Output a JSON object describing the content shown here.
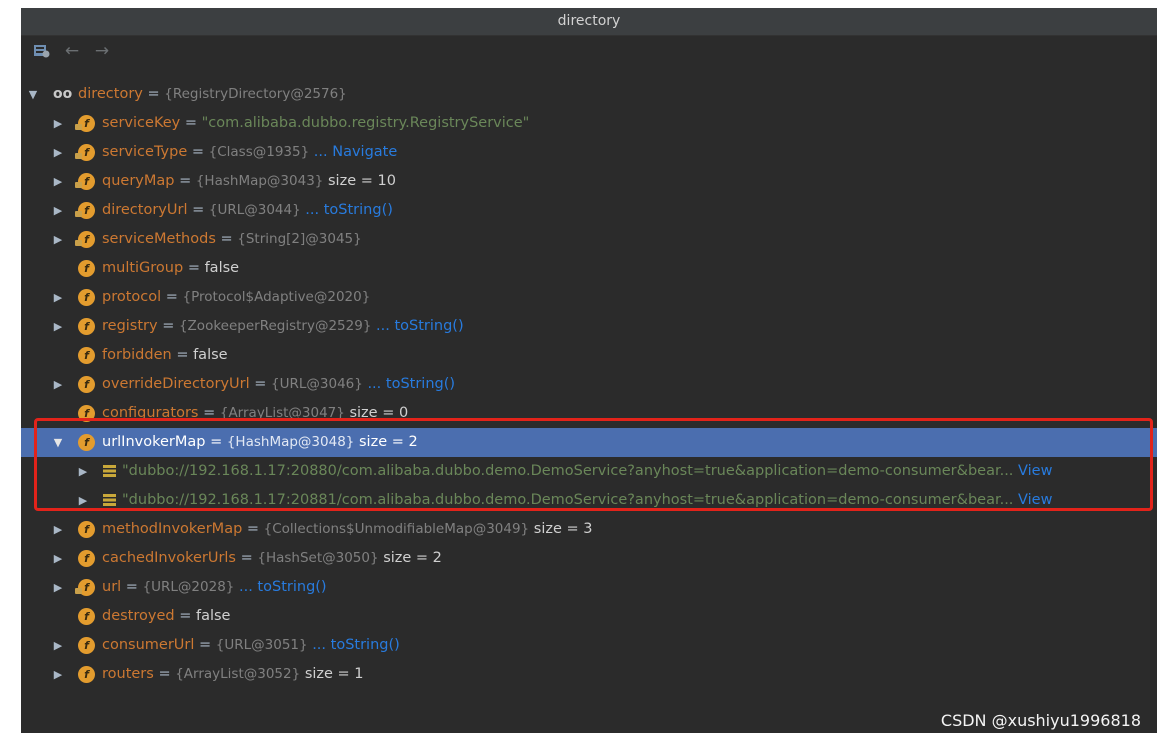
{
  "window": {
    "title": "directory"
  },
  "toolbar": {
    "back": "←",
    "forward": "→"
  },
  "tree": {
    "root": {
      "name": "directory",
      "eq": "=",
      "type": "{RegistryDirectory@2576}"
    },
    "rows": [
      {
        "name": "serviceKey",
        "eq": "=",
        "str": "\"com.alibaba.dubbo.registry.RegistryService\""
      },
      {
        "name": "serviceType",
        "eq": "=",
        "type": "{Class@1935}",
        "link": "... Navigate"
      },
      {
        "name": "queryMap",
        "eq": "=",
        "type": "{HashMap@3043}",
        "extra": "size = 10"
      },
      {
        "name": "directoryUrl",
        "eq": "=",
        "type": "{URL@3044}",
        "link": "... toString()"
      },
      {
        "name": "serviceMethods",
        "eq": "=",
        "type": "{String[2]@3045}"
      },
      {
        "name": "multiGroup",
        "eq": "=",
        "extra": "false"
      },
      {
        "name": "protocol",
        "eq": "=",
        "type": "{Protocol$Adaptive@2020}"
      },
      {
        "name": "registry",
        "eq": "=",
        "type": "{ZookeeperRegistry@2529}",
        "link": "... toString()"
      },
      {
        "name": "forbidden",
        "eq": "=",
        "extra": "false"
      },
      {
        "name": "overrideDirectoryUrl",
        "eq": "=",
        "type": "{URL@3046}",
        "link": "... toString()"
      },
      {
        "name": "configurators",
        "eq": "=",
        "type": "{ArrayList@3047}",
        "extra": "size = 0"
      },
      {
        "name": "urlInvokerMap",
        "eq": "=",
        "type": "{HashMap@3048}",
        "extra": "size = 2"
      },
      {
        "str": "\"dubbo://192.168.1.17:20880/com.alibaba.dubbo.demo.DemoService?anyhost=true&application=demo-consumer&bear...",
        "link": "View"
      },
      {
        "str": "\"dubbo://192.168.1.17:20881/com.alibaba.dubbo.demo.DemoService?anyhost=true&application=demo-consumer&bear...",
        "link": "View"
      },
      {
        "name": "methodInvokerMap",
        "eq": "=",
        "type": "{Collections$UnmodifiableMap@3049}",
        "extra": "size = 3"
      },
      {
        "name": "cachedInvokerUrls",
        "eq": "=",
        "type": "{HashSet@3050}",
        "extra": "size = 2"
      },
      {
        "name": "url",
        "eq": "=",
        "type": "{URL@2028}",
        "link": "... toString()"
      },
      {
        "name": "destroyed",
        "eq": "=",
        "extra": "false"
      },
      {
        "name": "consumerUrl",
        "eq": "=",
        "type": "{URL@3051}",
        "link": "... toString()"
      },
      {
        "name": "routers",
        "eq": "=",
        "type": "{ArrayList@3052}",
        "extra": "size = 1"
      }
    ]
  },
  "icons": {
    "field": "f"
  },
  "watermark": "CSDN @xushiyu1996818",
  "colors": {
    "background": "#2b2b2b",
    "selection": "#4b6eaf",
    "field_name": "#cc7832",
    "string": "#6a8759",
    "link": "#287bde",
    "highlight_box": "#e2231a"
  }
}
